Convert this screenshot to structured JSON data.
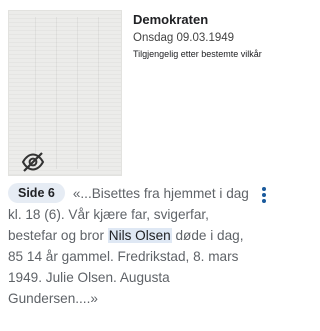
{
  "result": {
    "title": "Demokraten",
    "date": "Onsdag 09.03.1949",
    "access": "Tilgjengelig etter bestemte vilkår",
    "page_label": "Side 6",
    "snippet_before": "«...Bisettes fra hjemmet i dag kl. 18 (6). Vår kjære far, svigerfar, bestefar og bror ",
    "snippet_highlight": "Nils Olsen",
    "snippet_after": " døde i dag, 85 14 år gammel. Fredrikstad, 8. mars 1949. Julie Olsen. Augusta Gundersen....»",
    "thumbnail_icon": "eye-off-icon",
    "menu_icon": "more-vert-icon"
  },
  "colors": {
    "highlight": "#dfe8f4",
    "badge": "#e6ecf4",
    "menu": "#1a5a9c"
  }
}
